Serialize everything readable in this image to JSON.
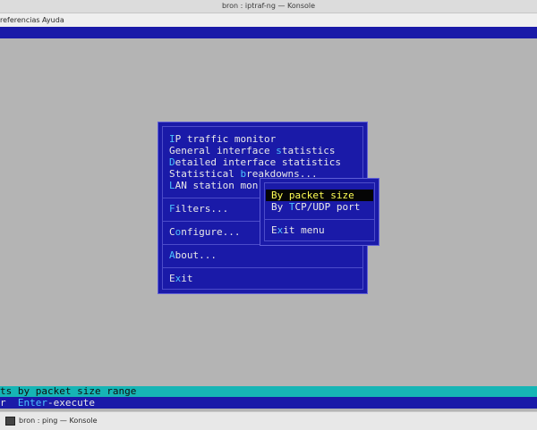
{
  "window": {
    "title": "bron : iptraf-ng — Konsole",
    "menus": [
      "referencias",
      "Ayuda"
    ]
  },
  "main_menu": {
    "items": [
      {
        "pre": "",
        "hot": "I",
        "post": "P traffic monitor"
      },
      {
        "pre": "General interface ",
        "hot": "s",
        "post": "tatistics"
      },
      {
        "pre": "",
        "hot": "D",
        "post": "etailed interface statistics"
      },
      {
        "pre": "Statistical ",
        "hot": "b",
        "post": "reakdowns..."
      },
      {
        "pre": "",
        "hot": "L",
        "post": "AN station mon"
      },
      {
        "pre": "",
        "hot": "F",
        "post": "ilters..."
      },
      {
        "pre": "C",
        "hot": "o",
        "post": "nfigure..."
      },
      {
        "pre": "",
        "hot": "A",
        "post": "bout..."
      },
      {
        "pre": "E",
        "hot": "x",
        "post": "it"
      }
    ]
  },
  "sub_menu": {
    "items": [
      {
        "pre": "By ",
        "hot": "p",
        "post": "acket size",
        "selected": true
      },
      {
        "pre": "By ",
        "hot": "T",
        "post": "CP/UDP port",
        "selected": false
      },
      {
        "pre": "E",
        "hot": "x",
        "post": "it menu",
        "selected": false
      }
    ]
  },
  "status": {
    "description": "ts by packet size range",
    "hint_prefix": "r  ",
    "hint_key": "Enter",
    "hint_suffix": "-execute"
  },
  "taskbar": {
    "item_label": "bron : ping — Konsole",
    "icon": "terminal-icon"
  },
  "colors": {
    "menu_bg": "#1a1aa8",
    "hotkey": "#4cc4ff",
    "selection_bg": "#050505",
    "selection_fg": "#ffff55",
    "status_bar": "#16b5b5"
  }
}
